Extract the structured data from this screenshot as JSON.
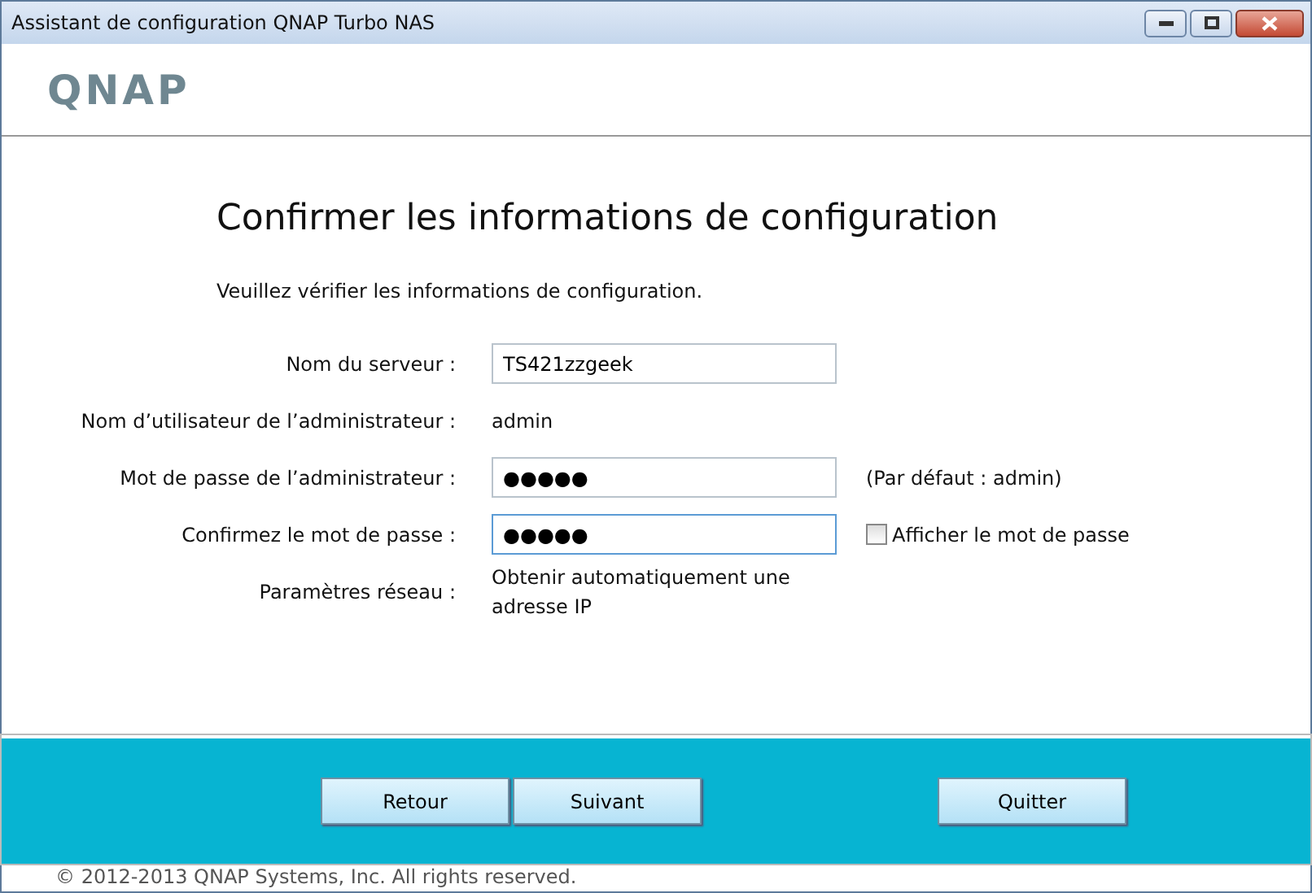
{
  "window": {
    "title": "Assistant de configuration QNAP Turbo NAS"
  },
  "logo": "QNAP",
  "heading": "Confirmer les informations de configuration",
  "instruction": "Veuillez vérifier les informations de configuration.",
  "rows": [
    {
      "kind": "field",
      "label": "Nom du serveur :",
      "value": "TS421zzgeek",
      "focused": false
    },
    {
      "kind": "text",
      "label": "Nom d’utilisateur de l’administrateur :",
      "value": "admin"
    },
    {
      "kind": "field",
      "label": "Mot de passe de l’administrateur :",
      "value": "●●●●●",
      "focused": false,
      "note": "(Par défaut : admin)"
    },
    {
      "kind": "field",
      "label": "Confirmez le mot de passe :",
      "value": "●●●●●",
      "focused": true,
      "checkbox": {
        "label": "Afficher le mot de passe",
        "checked": false
      }
    },
    {
      "kind": "text",
      "label": "Paramètres réseau :",
      "value": "Obtenir automatiquement une adresse IP"
    }
  ],
  "buttons": [
    "Retour",
    "Suivant",
    "Quitter"
  ],
  "copyright": "© 2012-2013 QNAP Systems, Inc. All rights reserved."
}
